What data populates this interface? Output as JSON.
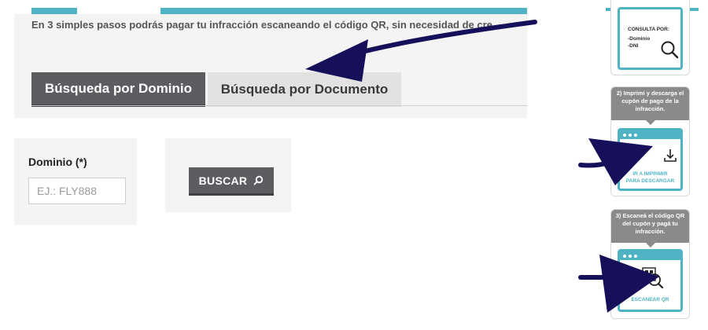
{
  "header": {
    "intro_text": "En 3 simples pasos podrás pagar tu infracción escaneando el código QR, sin necesidad de cre"
  },
  "tabs": [
    {
      "label": "Búsqueda por Dominio",
      "active": true
    },
    {
      "label": "Búsqueda por Documento",
      "active": false
    }
  ],
  "form": {
    "field_label": "Dominio (*)",
    "field_placeholder": "EJ.: FLY888",
    "search_button_label": "BUSCAR"
  },
  "steps": {
    "step1": {
      "title": "CONSULTA POR:",
      "line1": "-Dominio",
      "line2": "-DNI"
    },
    "step2": {
      "header": "2) Imprimí y descarga el cupón de pago de la infracción.",
      "cta_line1": "IR A IMPRIMIR",
      "cta_line2": "PARA DESCARGAR"
    },
    "step3": {
      "header": "3) Escaneá el código QR del cupón y pagá tu infracción.",
      "cta": "ESCANEAR QR"
    }
  },
  "colors": {
    "accent": "#4fb3c4",
    "tab_active": "#5b5d60",
    "arrow": "#16105a"
  }
}
